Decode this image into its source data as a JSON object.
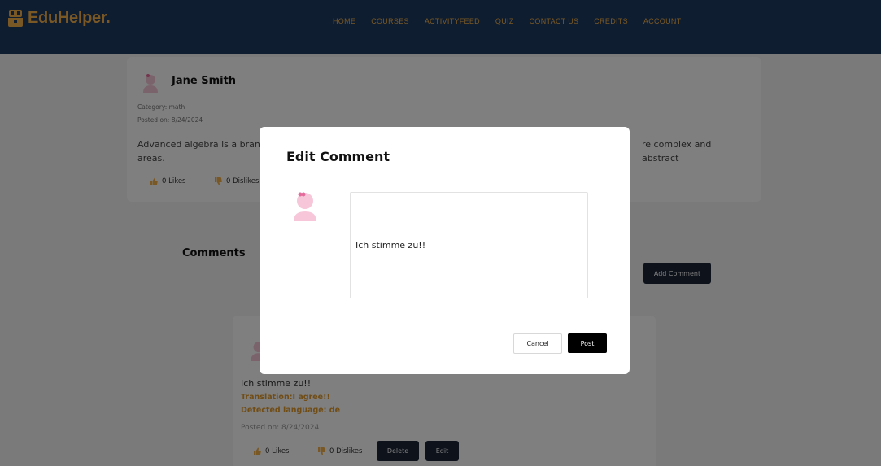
{
  "header": {
    "brand": "EduHelper.",
    "brand_icon": "edu-helper-logo-icon",
    "nav": [
      {
        "label": "HOME"
      },
      {
        "label": "COURSES"
      },
      {
        "label": "ACTIVITYFEED"
      },
      {
        "label": "QUIZ"
      },
      {
        "label": "CONTACT US"
      },
      {
        "label": "CREDITS"
      },
      {
        "label": "ACCOUNT"
      }
    ],
    "colors": {
      "background": "#1f3a60",
      "accent": "#f2b04a"
    }
  },
  "post": {
    "author": "Jane Smith",
    "category": "Category: math",
    "posted_on": "Posted on: 8/24/2024",
    "body_start": "Advanced algebra is a branch",
    "body_end": "re complex and abstract",
    "body_line2": "areas.",
    "likes": "0 Likes",
    "dislikes": "0 Dislikes"
  },
  "comments": {
    "heading": "Comments",
    "add_button": "Add Comment",
    "items": [
      {
        "text": "Ich stimme zu!!",
        "translation": "Translation:I agree!!",
        "detected_language": "Detected language: de",
        "posted_on": "Posted on: 8/24/2024",
        "likes": "0 Likes",
        "dislikes": "0 Dislikes",
        "delete_label": "Delete",
        "edit_label": "Edit"
      }
    ]
  },
  "modal": {
    "title": "Edit Comment",
    "textarea_value": "Ich stimme zu!!",
    "cancel_label": "Cancel",
    "post_label": "Post"
  }
}
